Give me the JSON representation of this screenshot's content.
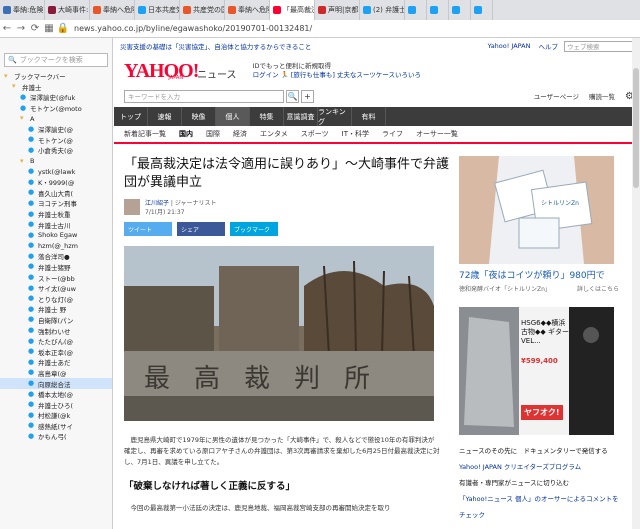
{
  "tabs": [
    {
      "label": "奉納:危険",
      "color": "#3b6fb6"
    },
    {
      "label": "大崎事件:",
      "color": "#8a1a3a"
    },
    {
      "label": "奉納へ危険",
      "color": "#e8562a"
    },
    {
      "label": "日本共産党",
      "color": "#1da1f2"
    },
    {
      "label": "共産党の国",
      "color": "#e8562a"
    },
    {
      "label": "奉納へ危険",
      "color": "#e8562a"
    },
    {
      "label": "「最高裁決",
      "color": "#ff0033",
      "active": true
    },
    {
      "label": "声明|京都",
      "color": "#cc2a2a"
    },
    {
      "label": "(2) 弁護士",
      "color": "#1da1f2"
    },
    {
      "label": "",
      "color": "#1da1f2"
    },
    {
      "label": "",
      "color": "#1da1f2"
    },
    {
      "label": "",
      "color": "#1da1f2"
    },
    {
      "label": "",
      "color": "#1da1f2"
    }
  ],
  "url": "news.yahoo.co.jp/byline/egawashoko/20190701-00132481/",
  "sidebar": {
    "search_placeholder": "ブックマークを検索",
    "items": [
      {
        "label": "ブックマークバー",
        "type": "folder",
        "indent": 0
      },
      {
        "label": "弁護士",
        "type": "folder",
        "indent": 1
      },
      {
        "label": "深澤諭史(@fuk",
        "type": "tw",
        "indent": 2
      },
      {
        "label": "モトケン(@moto",
        "type": "tw",
        "indent": 2
      },
      {
        "label": "A",
        "type": "folder",
        "indent": 2
      },
      {
        "label": "深澤諭史(@",
        "type": "tw",
        "indent": 3
      },
      {
        "label": "モトケン(@",
        "type": "tw",
        "indent": 3
      },
      {
        "label": "小倉秀夫(@",
        "type": "tw",
        "indent": 3
      },
      {
        "label": "B",
        "type": "folder",
        "indent": 2
      },
      {
        "label": "ystk(@lawk",
        "type": "tw",
        "indent": 3
      },
      {
        "label": "K・9999(@",
        "type": "tw",
        "indent": 3
      },
      {
        "label": "喜久山大貴(",
        "type": "tw",
        "indent": 3
      },
      {
        "label": "ヨコテン刑事",
        "type": "tw",
        "indent": 3
      },
      {
        "label": "弁護士秋重",
        "type": "tw",
        "indent": 3
      },
      {
        "label": "弁護士古川",
        "type": "tw",
        "indent": 3
      },
      {
        "label": "Shoko Egaw",
        "type": "tw",
        "indent": 3
      },
      {
        "label": "hzm(@_hzm",
        "type": "tw",
        "indent": 3
      },
      {
        "label": "落合洋司●",
        "type": "tw",
        "indent": 3
      },
      {
        "label": "弁護士猪野",
        "type": "tw",
        "indent": 3
      },
      {
        "label": "ストー(@bb",
        "type": "tw",
        "indent": 3
      },
      {
        "label": "サイ太(@uw",
        "type": "tw",
        "indent": 3
      },
      {
        "label": "とりな灯(@",
        "type": "tw",
        "indent": 3
      },
      {
        "label": "弁護士 野",
        "type": "tw",
        "indent": 3
      },
      {
        "label": "自衛隊(パン",
        "type": "tw",
        "indent": 3
      },
      {
        "label": "強制わいせ",
        "type": "tw",
        "indent": 3
      },
      {
        "label": "たたびん(@",
        "type": "tw",
        "indent": 3
      },
      {
        "label": "坂本正幸(@",
        "type": "tw",
        "indent": 3
      },
      {
        "label": "弁護士あだ",
        "type": "tw",
        "indent": 3
      },
      {
        "label": "高島章(@",
        "type": "tw",
        "indent": 3
      },
      {
        "label": "向原総合法",
        "type": "tw",
        "indent": 3,
        "selected": true
      },
      {
        "label": "橋本太地(@",
        "type": "tw",
        "indent": 3
      },
      {
        "label": "弁護士ひろ(",
        "type": "tw",
        "indent": 3
      },
      {
        "label": "村松謙(@k",
        "type": "tw",
        "indent": 3
      },
      {
        "label": "感熱紙(サイ",
        "type": "tw",
        "indent": 3
      },
      {
        "label": "かもん弓(",
        "type": "tw",
        "indent": 3
      }
    ]
  },
  "page": {
    "topstrip_left": "災害支援の基礎は「災害協定」、自治体と協力するからできること",
    "topstrip_right": [
      "Yahoo! JAPAN",
      "ヘルプ"
    ],
    "topstrip_search_placeholder": "ウェブ検索",
    "logo": "YAHOO!",
    "logo_sub": "JAPAN",
    "logo_news": "ニュース",
    "hdr_line1": "IDでもっと便利に新規取得",
    "hdr_line2": "ログイン 🏃 [旅行も仕事も] 丈夫なスーツケースいろいろ",
    "kw_placeholder": "キーワードを入力",
    "sr_right": [
      "ユーザーページ",
      "購読一覧"
    ],
    "nav": [
      "トップ",
      "速報",
      "映像",
      "個人",
      "特集",
      "意識調査",
      "ランキング",
      "有料"
    ],
    "nav_active": 3,
    "subnav": [
      "新着記事一覧",
      "国内",
      "国際",
      "経済",
      "エンタメ",
      "スポーツ",
      "IT・科学",
      "ライフ",
      "オーサー一覧"
    ],
    "subnav_active": 1,
    "title": "「最高裁決定は法令適用に誤りあり」〜大崎事件で弁護団が異議申立",
    "author": "江川紹子",
    "author_role": "ジャーナリスト",
    "date": "7/1(月) 21:37",
    "share": [
      {
        "label": "ツイート",
        "color": "#55acee"
      },
      {
        "label": "シェア",
        "color": "#3b5998"
      },
      {
        "label": "ブックマーク",
        "color": "#00a4de"
      }
    ],
    "photo_text": "最高裁判所",
    "body1": "鹿児島県大崎町で1979年に男性の遺体が見つかった「大崎事件」で、殺人などで懲役10年の有罪判決が確定し、再審を求めている原口アヤ子さんの弁護団は、第3次再審請求を棄却した6月25日付最高裁決定に対し、7月1日、異議を申し立てた。",
    "subheading": "「破棄しなければ著しく正義に反する」",
    "body2": "今回の最高裁第一小法廷の決定は、鹿児島地裁、福岡高裁宮崎支部の再審開始決定を取り",
    "ad1_title": "72歳「夜はコイツが頼り」980円で",
    "ad1_brand": "シトルリンZn",
    "ad1_source": "徳和発酵バイオ「シトルリンZn」",
    "ad1_more": "詳しくはこちら",
    "ad2_text": "HSG6◆◆横浜 古物◆◆ ギター VEL...",
    "ad2_price": "¥599,400",
    "ad2_badge": "ヤフオク!",
    "right_links": [
      {
        "text": "ニュースのその先に　ドキュメンタリーで発信する",
        "kind": "h"
      },
      {
        "text": "Yahoo! JAPAN クリエイターズプログラム",
        "kind": "l"
      },
      {
        "text": "有識者・専門家がニュースに切り込む",
        "kind": "h"
      },
      {
        "text": "「Yahoo!ニュース 個人」のオーサーによるコメントをチェック",
        "kind": "l"
      }
    ]
  }
}
